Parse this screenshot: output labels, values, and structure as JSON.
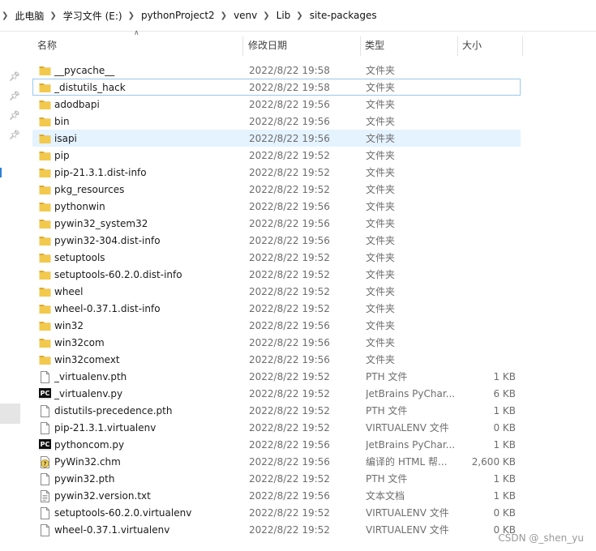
{
  "breadcrumb": [
    "此电脑",
    "学习文件 (E:)",
    "pythonProject2",
    "venv",
    "Lib",
    "site-packages"
  ],
  "columns": {
    "name": "名称",
    "date": "修改日期",
    "type": "类型",
    "size": "大小"
  },
  "files": [
    {
      "name": "__pycache__",
      "date": "2022/8/22 19:58",
      "type": "文件夹",
      "size": "",
      "icon": "folder"
    },
    {
      "name": "_distutils_hack",
      "date": "2022/8/22 19:58",
      "type": "文件夹",
      "size": "",
      "icon": "folder"
    },
    {
      "name": "adodbapi",
      "date": "2022/8/22 19:56",
      "type": "文件夹",
      "size": "",
      "icon": "folder"
    },
    {
      "name": "bin",
      "date": "2022/8/22 19:56",
      "type": "文件夹",
      "size": "",
      "icon": "folder"
    },
    {
      "name": "isapi",
      "date": "2022/8/22 19:56",
      "type": "文件夹",
      "size": "",
      "icon": "folder"
    },
    {
      "name": "pip",
      "date": "2022/8/22 19:52",
      "type": "文件夹",
      "size": "",
      "icon": "folder"
    },
    {
      "name": "pip-21.3.1.dist-info",
      "date": "2022/8/22 19:52",
      "type": "文件夹",
      "size": "",
      "icon": "folder"
    },
    {
      "name": "pkg_resources",
      "date": "2022/8/22 19:52",
      "type": "文件夹",
      "size": "",
      "icon": "folder"
    },
    {
      "name": "pythonwin",
      "date": "2022/8/22 19:56",
      "type": "文件夹",
      "size": "",
      "icon": "folder"
    },
    {
      "name": "pywin32_system32",
      "date": "2022/8/22 19:56",
      "type": "文件夹",
      "size": "",
      "icon": "folder"
    },
    {
      "name": "pywin32-304.dist-info",
      "date": "2022/8/22 19:56",
      "type": "文件夹",
      "size": "",
      "icon": "folder"
    },
    {
      "name": "setuptools",
      "date": "2022/8/22 19:52",
      "type": "文件夹",
      "size": "",
      "icon": "folder"
    },
    {
      "name": "setuptools-60.2.0.dist-info",
      "date": "2022/8/22 19:52",
      "type": "文件夹",
      "size": "",
      "icon": "folder"
    },
    {
      "name": "wheel",
      "date": "2022/8/22 19:52",
      "type": "文件夹",
      "size": "",
      "icon": "folder"
    },
    {
      "name": "wheel-0.37.1.dist-info",
      "date": "2022/8/22 19:52",
      "type": "文件夹",
      "size": "",
      "icon": "folder"
    },
    {
      "name": "win32",
      "date": "2022/8/22 19:56",
      "type": "文件夹",
      "size": "",
      "icon": "folder"
    },
    {
      "name": "win32com",
      "date": "2022/8/22 19:56",
      "type": "文件夹",
      "size": "",
      "icon": "folder"
    },
    {
      "name": "win32comext",
      "date": "2022/8/22 19:56",
      "type": "文件夹",
      "size": "",
      "icon": "folder"
    },
    {
      "name": "_virtualenv.pth",
      "date": "2022/8/22 19:52",
      "type": "PTH 文件",
      "size": "1 KB",
      "icon": "file"
    },
    {
      "name": "_virtualenv.py",
      "date": "2022/8/22 19:52",
      "type": "JetBrains PyChar...",
      "size": "6 KB",
      "icon": "pycharm"
    },
    {
      "name": "distutils-precedence.pth",
      "date": "2022/8/22 19:52",
      "type": "PTH 文件",
      "size": "1 KB",
      "icon": "file"
    },
    {
      "name": "pip-21.3.1.virtualenv",
      "date": "2022/8/22 19:52",
      "type": "VIRTUALENV 文件",
      "size": "0 KB",
      "icon": "file"
    },
    {
      "name": "pythoncom.py",
      "date": "2022/8/22 19:56",
      "type": "JetBrains PyChar...",
      "size": "1 KB",
      "icon": "pycharm"
    },
    {
      "name": "PyWin32.chm",
      "date": "2022/8/22 19:56",
      "type": "编译的 HTML 帮...",
      "size": "2,600 KB",
      "icon": "help"
    },
    {
      "name": "pywin32.pth",
      "date": "2022/8/22 19:52",
      "type": "PTH 文件",
      "size": "1 KB",
      "icon": "file"
    },
    {
      "name": "pywin32.version.txt",
      "date": "2022/8/22 19:56",
      "type": "文本文档",
      "size": "1 KB",
      "icon": "text"
    },
    {
      "name": "setuptools-60.2.0.virtualenv",
      "date": "2022/8/22 19:52",
      "type": "VIRTUALENV 文件",
      "size": "0 KB",
      "icon": "file"
    },
    {
      "name": "wheel-0.37.1.virtualenv",
      "date": "2022/8/22 19:52",
      "type": "VIRTUALENV 文件",
      "size": "0 KB",
      "icon": "file"
    }
  ],
  "state": {
    "focused_row": 1,
    "hovered_row": 4
  },
  "watermark": "CSDN @_shen_yu",
  "colors": {
    "folder": "#f2c94c",
    "folder_dark": "#dcaa2e",
    "hover": "#e5f3ff",
    "focus_border": "#99c9ef"
  }
}
